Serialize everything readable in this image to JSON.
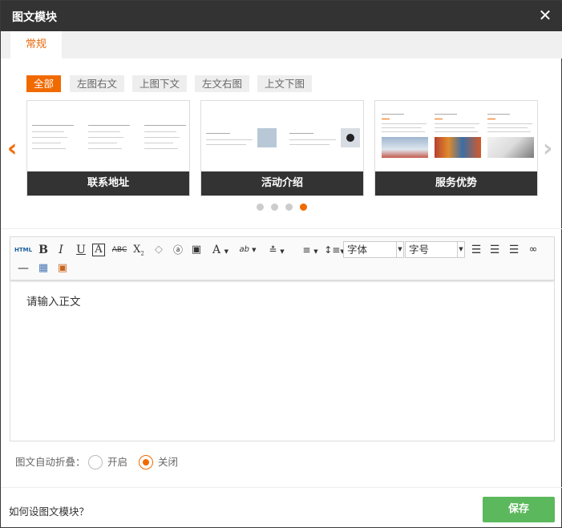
{
  "dialog": {
    "title": "图文模块"
  },
  "tabs": [
    {
      "label": "常规"
    }
  ],
  "filters": [
    {
      "label": "全部",
      "active": true
    },
    {
      "label": "左图右文",
      "active": false
    },
    {
      "label": "上图下文",
      "active": false
    },
    {
      "label": "左文右图",
      "active": false
    },
    {
      "label": "上文下图",
      "active": false
    }
  ],
  "carousel": {
    "cards": [
      {
        "label": "联系地址"
      },
      {
        "label": "活动介绍"
      },
      {
        "label": "服务优势"
      }
    ],
    "page_count": 4,
    "current_page": 4
  },
  "toolbar": {
    "font_select": "字体",
    "size_select": "字号"
  },
  "editor": {
    "placeholder": "请输入正文"
  },
  "fold": {
    "label": "图文自动折叠：",
    "options": [
      {
        "label": "开启",
        "checked": false
      },
      {
        "label": "关闭",
        "checked": true
      }
    ]
  },
  "footer": {
    "help_link": "如何设图文模块？",
    "save_label": "保存"
  },
  "colors": {
    "accent": "#f06a00",
    "titlebar": "#333333",
    "save": "#5cb85c"
  }
}
